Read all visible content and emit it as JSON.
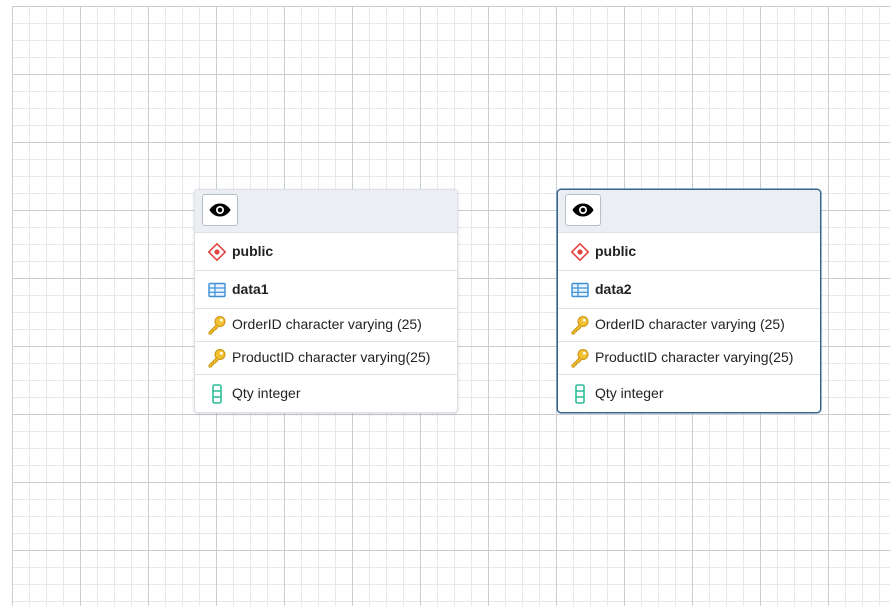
{
  "colors": {
    "schema_icon": "#e0463f",
    "table_icon": "#3d8fd6",
    "key_icon": "#e5b31f",
    "column_icon": "#2fbc9a",
    "selected_border": "#326690",
    "header_bg": "#ebeef3"
  },
  "tables": [
    {
      "toggle_icon": "eye-icon",
      "schema": "public",
      "name": "data1",
      "selected": false,
      "columns": [
        {
          "text": "OrderID character varying (25)",
          "icon": "key-icon"
        },
        {
          "text": "ProductID character varying(25)",
          "icon": "key-icon"
        },
        {
          "text": "Qty integer",
          "icon": "column-icon"
        }
      ]
    },
    {
      "toggle_icon": "eye-icon",
      "schema": "public",
      "name": "data2",
      "selected": true,
      "columns": [
        {
          "text": "OrderID character varying (25)",
          "icon": "key-icon"
        },
        {
          "text": "ProductID character varying(25)",
          "icon": "key-icon"
        },
        {
          "text": "Qty integer",
          "icon": "column-icon"
        }
      ]
    }
  ]
}
